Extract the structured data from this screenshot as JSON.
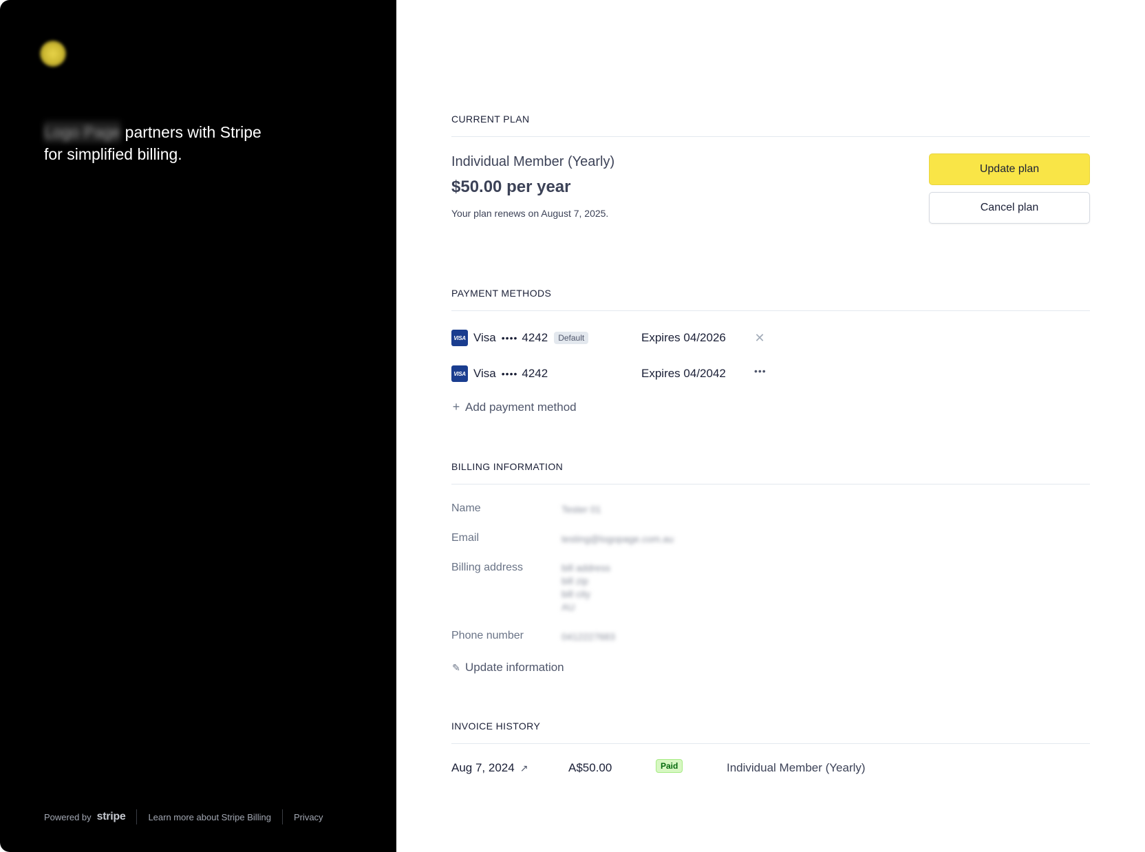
{
  "left_panel": {
    "tagline_brand": "Logo Page",
    "tagline_rest": "partners with Stripe for simplified billing.",
    "footer": {
      "powered_by": "Powered by",
      "stripe_logo_text": "stripe",
      "learn_more": "Learn more about Stripe Billing",
      "privacy": "Privacy"
    }
  },
  "current_plan": {
    "section_title": "CURRENT PLAN",
    "plan_name": "Individual Member (Yearly)",
    "price": "$50.00 per year",
    "renewal": "Your plan renews on August 7, 2025.",
    "update_button": "Update plan",
    "cancel_button": "Cancel plan"
  },
  "payment_methods": {
    "section_title": "PAYMENT METHODS",
    "items": [
      {
        "brand_icon": "VISA",
        "brand": "Visa",
        "dots": "••••",
        "last4": "4242",
        "badge": "Default",
        "expires": "Expires 04/2026",
        "action_icon": "close-icon"
      },
      {
        "brand_icon": "VISA",
        "brand": "Visa",
        "dots": "••••",
        "last4": "4242",
        "badge": "",
        "expires": "Expires 04/2042",
        "action_icon": "more-icon"
      }
    ],
    "add_label": "Add payment method"
  },
  "billing_information": {
    "section_title": "BILLING INFORMATION",
    "fields": {
      "name_label": "Name",
      "name_value": "Tester 01",
      "email_label": "Email",
      "email_value": "testing@logopage.com.au",
      "address_label": "Billing address",
      "address_lines": [
        "bill address",
        "bill zip",
        "bill city",
        "AU"
      ],
      "phone_label": "Phone number",
      "phone_value": "0412227683"
    },
    "update_label": "Update information"
  },
  "invoice_history": {
    "section_title": "INVOICE HISTORY",
    "rows": [
      {
        "date": "Aug 7, 2024",
        "amount": "A$50.00",
        "status": "Paid",
        "description": "Individual Member (Yearly)"
      }
    ]
  },
  "colors": {
    "left_background": "#000000",
    "primary_button": "#f9e547",
    "paid_badge_bg": "#d7f7c2",
    "visa_blue": "#1a3d8f"
  }
}
